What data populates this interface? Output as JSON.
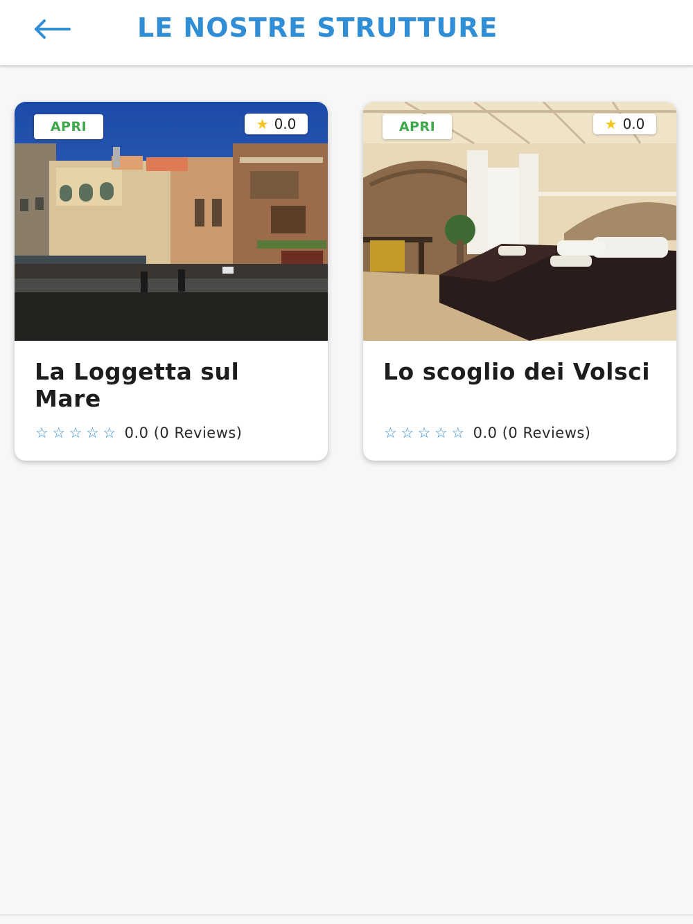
{
  "header": {
    "title": "LE NOSTRE STRUTTURE",
    "back_icon": "arrow-left-icon",
    "accent_color": "#2f8ed6"
  },
  "properties": [
    {
      "name": "La Loggetta sul Mare",
      "status": "APRI",
      "rating_badge": "0.0",
      "rating_value": 0.0,
      "stars_filled": 0,
      "reviews_text": "0.0 (0 Reviews)",
      "image": "photo of town square buildings"
    },
    {
      "name": "Lo scoglio dei Volsci",
      "status": "APRI",
      "rating_badge": "0.0",
      "rating_value": 0.0,
      "stars_filled": 0,
      "reviews_text": "0.0 (0 Reviews)",
      "image": "photo of bedroom with stone walls"
    }
  ],
  "colors": {
    "status_green": "#3ea84b",
    "star_yellow": "#f5c518",
    "star_outline": "#2f8ed6"
  }
}
